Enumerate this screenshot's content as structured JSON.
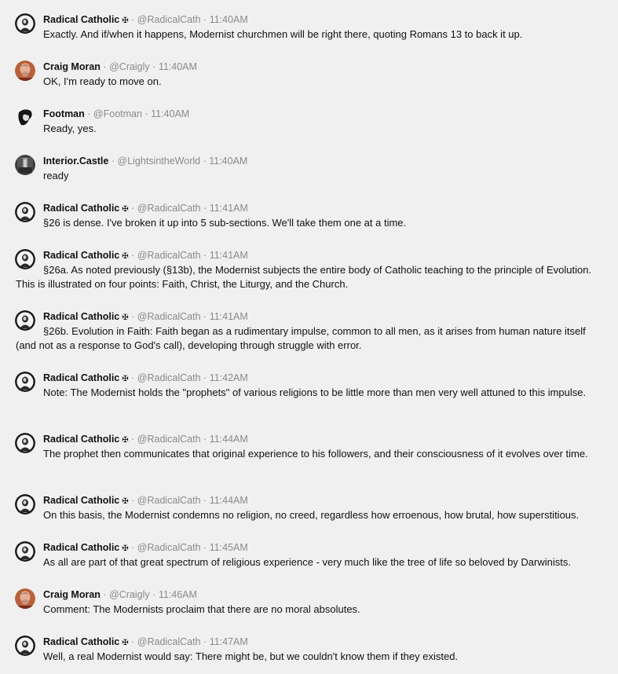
{
  "messages": [
    {
      "avatar": "radical",
      "name": "Radical Catholic",
      "badge": "✠",
      "handle": "@RadicalCath",
      "time": "11:40AM",
      "text": "Exactly. And if/when it happens, Modernist churchmen will be right there, quoting Romans 13 to back it up."
    },
    {
      "avatar": "craig",
      "name": "Craig Moran",
      "badge": "",
      "handle": "@Craigly",
      "time": "11:40AM",
      "text": "OK, I'm ready to move on."
    },
    {
      "avatar": "footman",
      "name": "Footman",
      "badge": "",
      "handle": "@Footman",
      "time": "11:40AM",
      "text": "Ready, yes."
    },
    {
      "avatar": "interior",
      "name": "Interior.Castle",
      "badge": "",
      "handle": "@LightsintheWorld",
      "time": "11:40AM",
      "text": "ready"
    },
    {
      "avatar": "radical",
      "name": "Radical Catholic",
      "badge": "✠",
      "handle": "@RadicalCath",
      "time": "11:41AM",
      "text": "§26 is dense. I've broken it up into 5 sub-sections. We'll take them one at a time."
    },
    {
      "avatar": "radical",
      "name": "Radical Catholic",
      "badge": "✠",
      "handle": "@RadicalCath",
      "time": "11:41AM",
      "text": "§26a. As noted previously (§13b), the Modernist subjects the entire body of Catholic teaching to the principle of Evolution. This is illustrated on four points: Faith, Christ, the Liturgy, and the Church."
    },
    {
      "avatar": "radical",
      "name": "Radical Catholic",
      "badge": "✠",
      "handle": "@RadicalCath",
      "time": "11:41AM",
      "text": "§26b. Evolution in Faith: Faith began as a rudimentary impulse, common to all men, as it arises from human nature itself (and not as a response to God's call), developing through struggle with error."
    },
    {
      "avatar": "radical",
      "name": "Radical Catholic",
      "badge": "✠",
      "handle": "@RadicalCath",
      "time": "11:42AM",
      "text": "Note: The Modernist holds the \"prophets\" of various religions to be little more than men very well attuned to this impulse."
    },
    {
      "avatar": "radical",
      "name": "Radical Catholic",
      "badge": "✠",
      "handle": "@RadicalCath",
      "time": "11:44AM",
      "text": "The prophet then communicates that original experience to his followers, and their consciousness of it evolves over time."
    },
    {
      "avatar": "radical",
      "name": "Radical Catholic",
      "badge": "✠",
      "handle": "@RadicalCath",
      "time": "11:44AM",
      "text": "On this basis, the Modernist condemns no religion, no creed, regardless how erroenous, how brutal, how superstitious."
    },
    {
      "avatar": "radical",
      "name": "Radical Catholic",
      "badge": "✠",
      "handle": "@RadicalCath",
      "time": "11:45AM",
      "text": "As all are part of that great spectrum of religious experience - very much like the tree of life so beloved by Darwinists."
    },
    {
      "avatar": "craig",
      "name": "Craig Moran",
      "badge": "",
      "handle": "@Craigly",
      "time": "11:46AM",
      "text": "Comment: The Modernists proclaim that there are no moral absolutes."
    },
    {
      "avatar": "radical",
      "name": "Radical Catholic",
      "badge": "✠",
      "handle": "@RadicalCath",
      "time": "11:47AM",
      "text": "Well, a real Modernist would say: There might be, but we couldn't know them if they existed."
    }
  ],
  "separator": "·",
  "colors": {
    "background": "#f0f0f0",
    "meta": "#8a8a8a",
    "text": "#111111"
  }
}
